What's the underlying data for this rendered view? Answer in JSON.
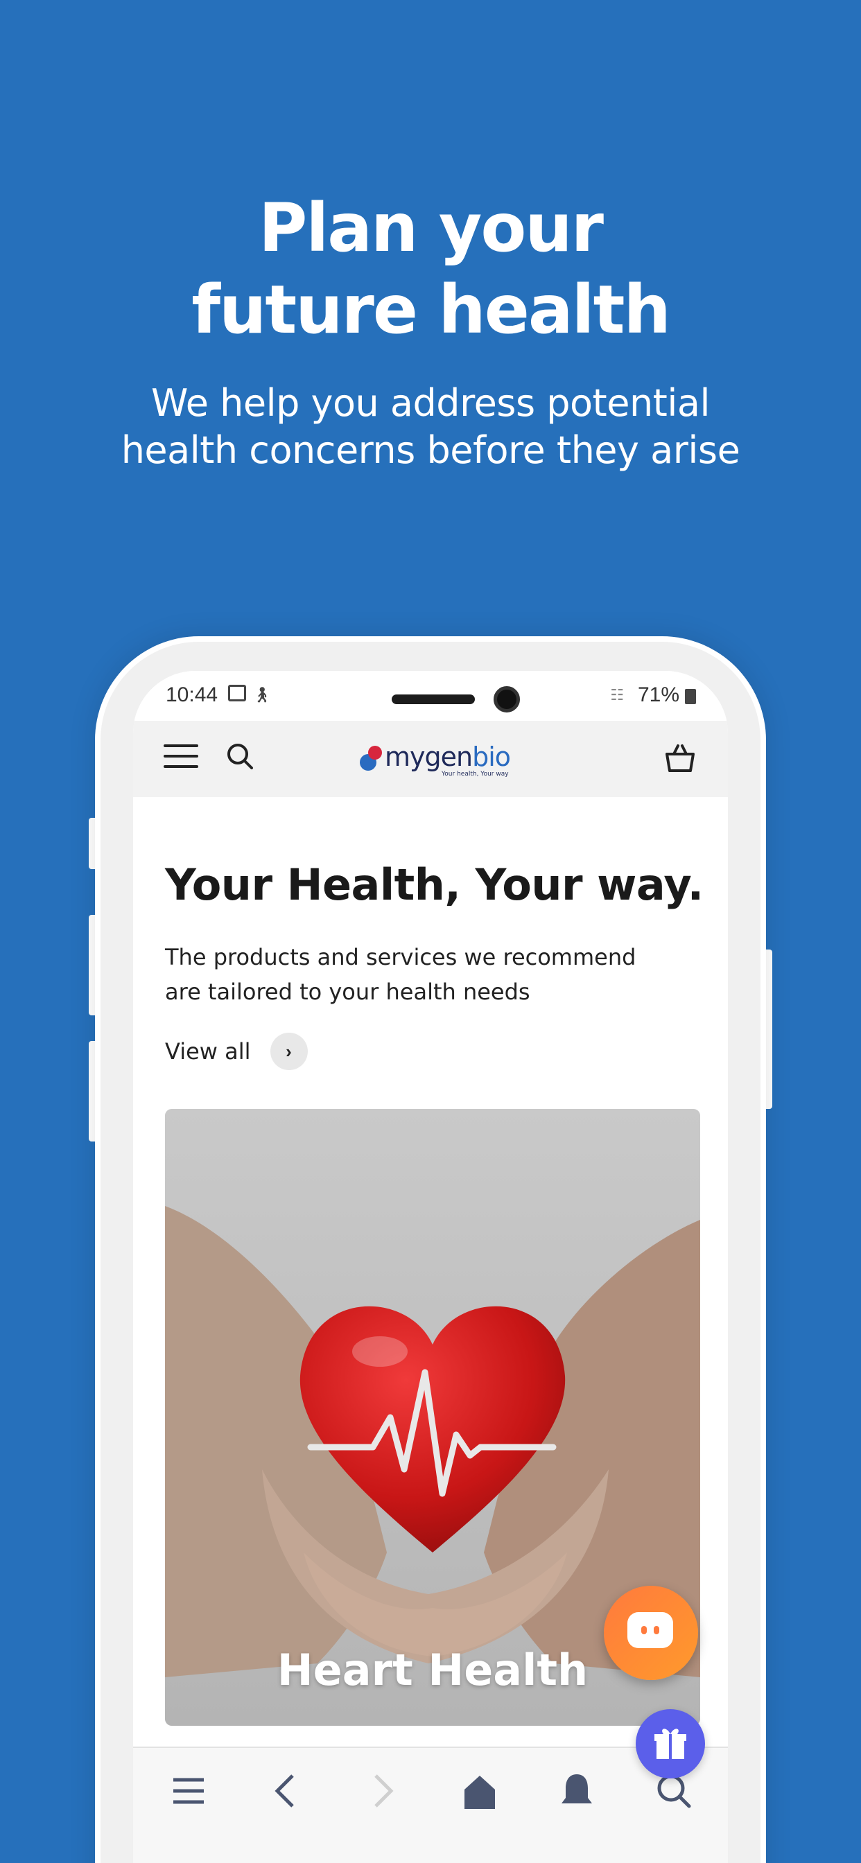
{
  "hero": {
    "title_line1": "Plan your",
    "title_line2": "future health",
    "subtitle_line1": "We help you address potential",
    "subtitle_line2": "health concerns before they arise"
  },
  "status_bar": {
    "time": "10:44",
    "battery": "71%"
  },
  "app_bar": {
    "logo_main": "mygen",
    "logo_accent": "bio",
    "logo_tagline": "Your health, Your way"
  },
  "content": {
    "heading": "Your Health, Your way.",
    "description": "The products and services we recommend are tailored to your health needs",
    "view_all": "View all",
    "card_title": "Heart Health"
  },
  "bottom_nav": {
    "items": [
      "menu-icon",
      "back-icon",
      "forward-icon",
      "home-icon",
      "bell-icon",
      "search-icon"
    ]
  },
  "colors": {
    "background": "#2670bb",
    "chat_button": "#ff8a34",
    "gift_button": "#5b5fea",
    "logo_red": "#d7263d",
    "logo_blue": "#2a6bc0"
  }
}
